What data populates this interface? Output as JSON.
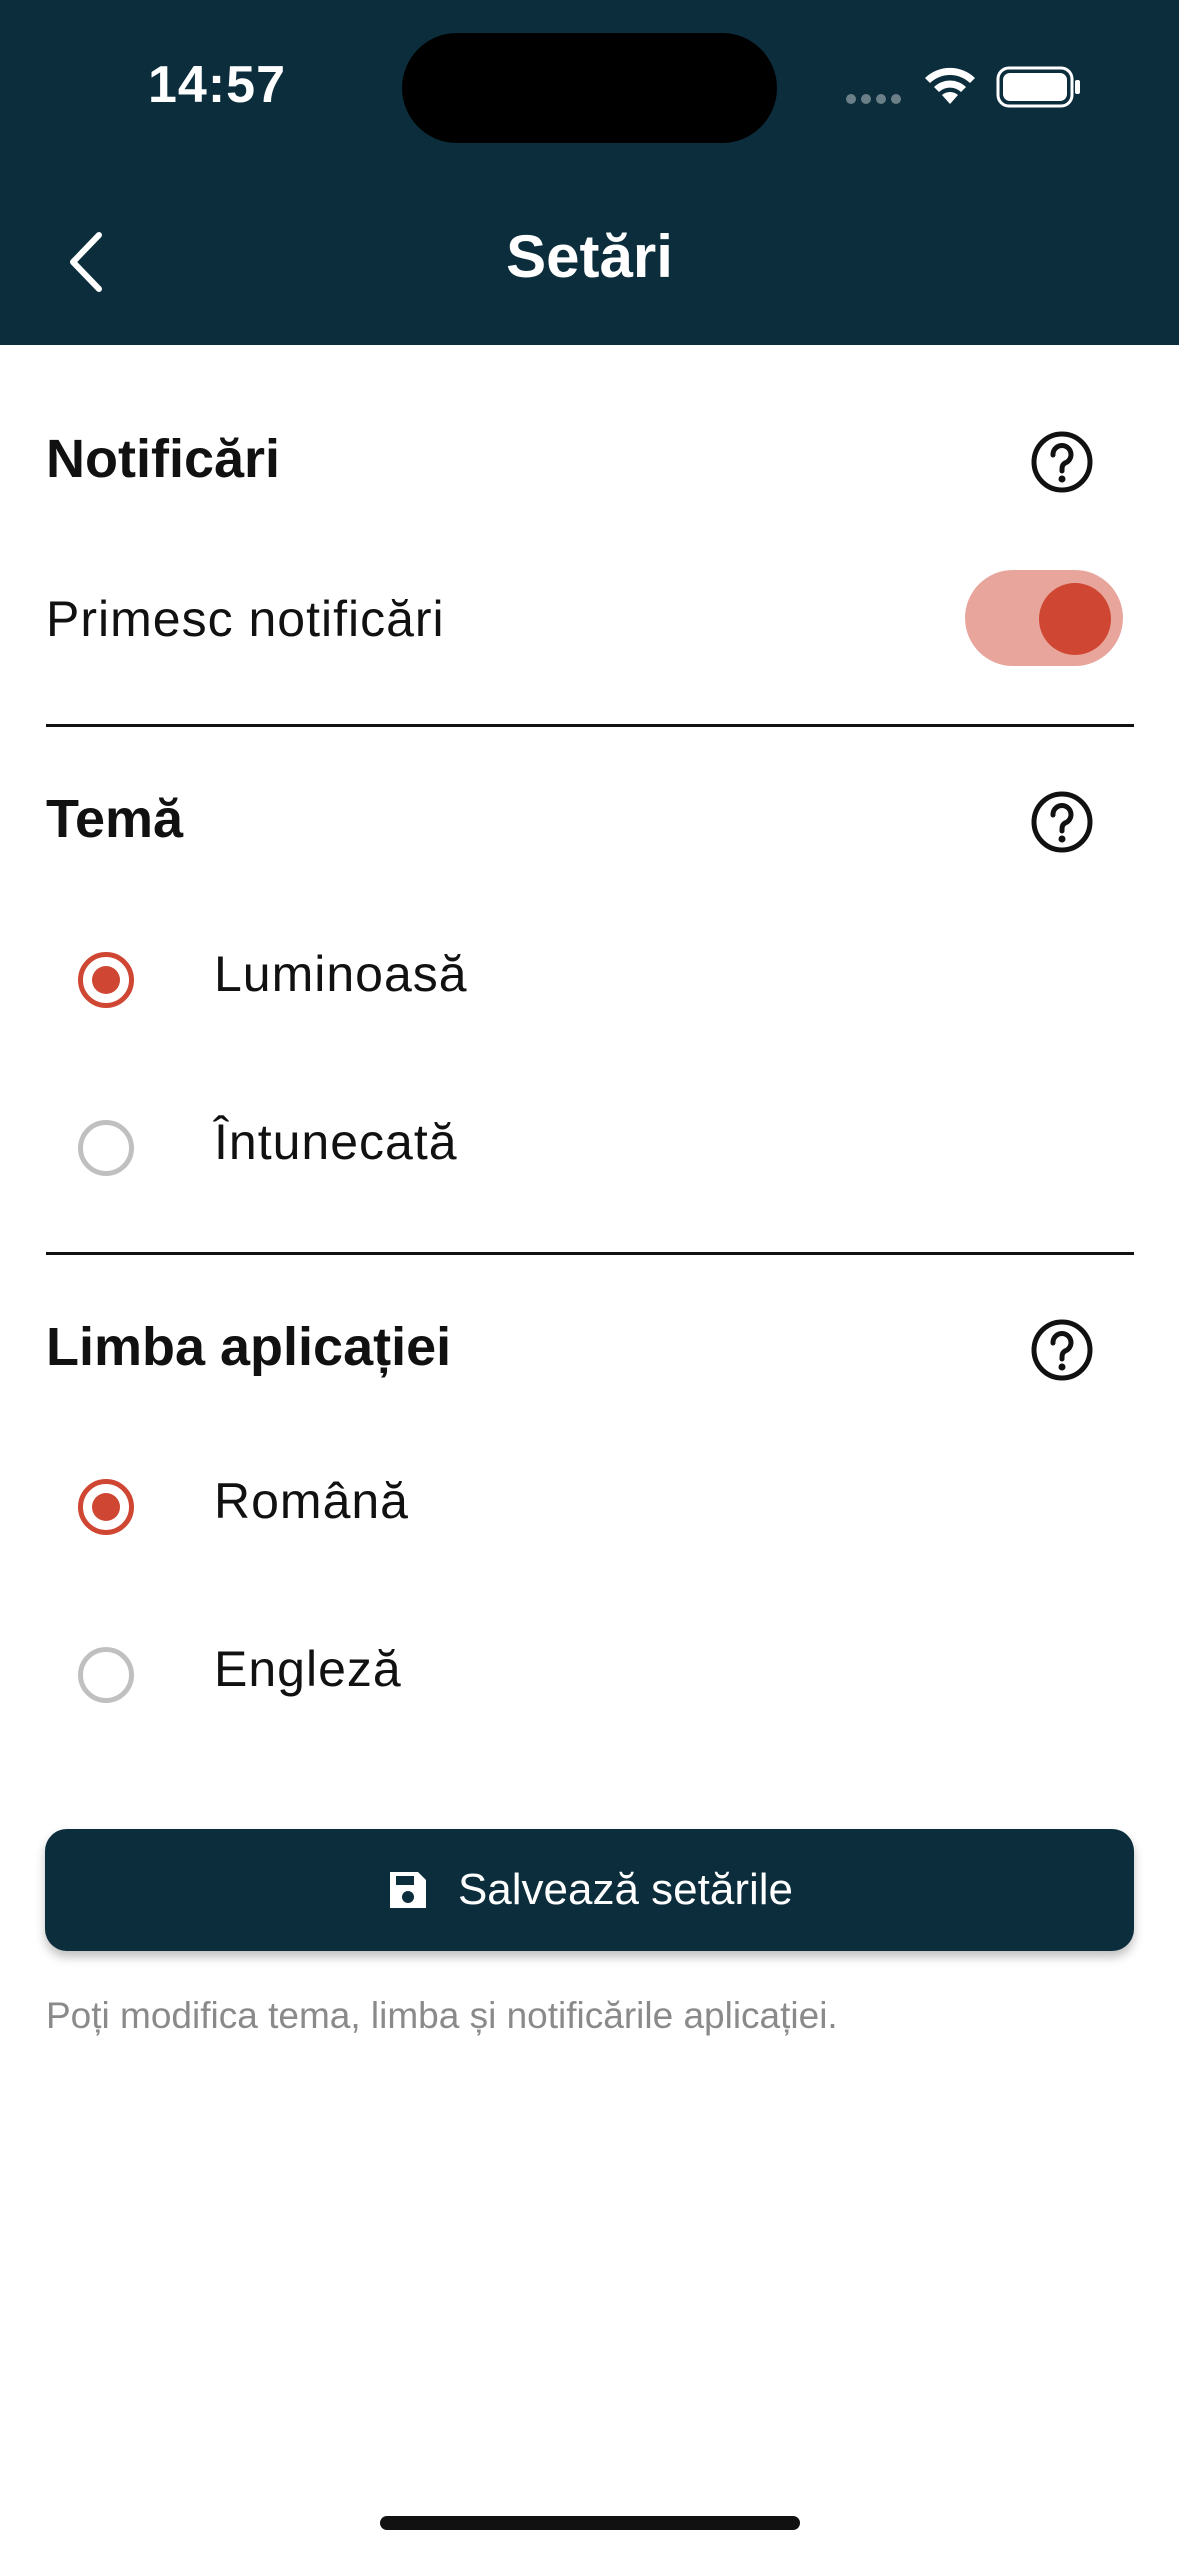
{
  "status_bar": {
    "time": "14:57",
    "icons": [
      "signal-dots-icon",
      "wifi-icon",
      "battery-icon"
    ]
  },
  "header": {
    "title": "Setări",
    "back_icon": "chevron-left-icon"
  },
  "notifications": {
    "title": "Notificări",
    "help_icon": "help-circle-icon",
    "toggle_label": "Primesc notificări",
    "toggle_on": true
  },
  "theme": {
    "title": "Temă",
    "help_icon": "help-circle-icon",
    "options": [
      {
        "label": "Luminoasă",
        "selected": true
      },
      {
        "label": "Întunecată",
        "selected": false
      }
    ]
  },
  "language": {
    "title": "Limba aplicației",
    "help_icon": "help-circle-icon",
    "options": [
      {
        "label": "Română",
        "selected": true
      },
      {
        "label": "Engleză",
        "selected": false
      }
    ]
  },
  "save": {
    "label": "Salvează setările",
    "icon": "save-icon"
  },
  "footnote": "Poți modifica tema, limba și notificările aplicației.",
  "colors": {
    "primary": "#0b2d3c",
    "accent": "#cf4633",
    "accent_light": "#e8a59b",
    "muted_text": "#8a8a8a"
  }
}
